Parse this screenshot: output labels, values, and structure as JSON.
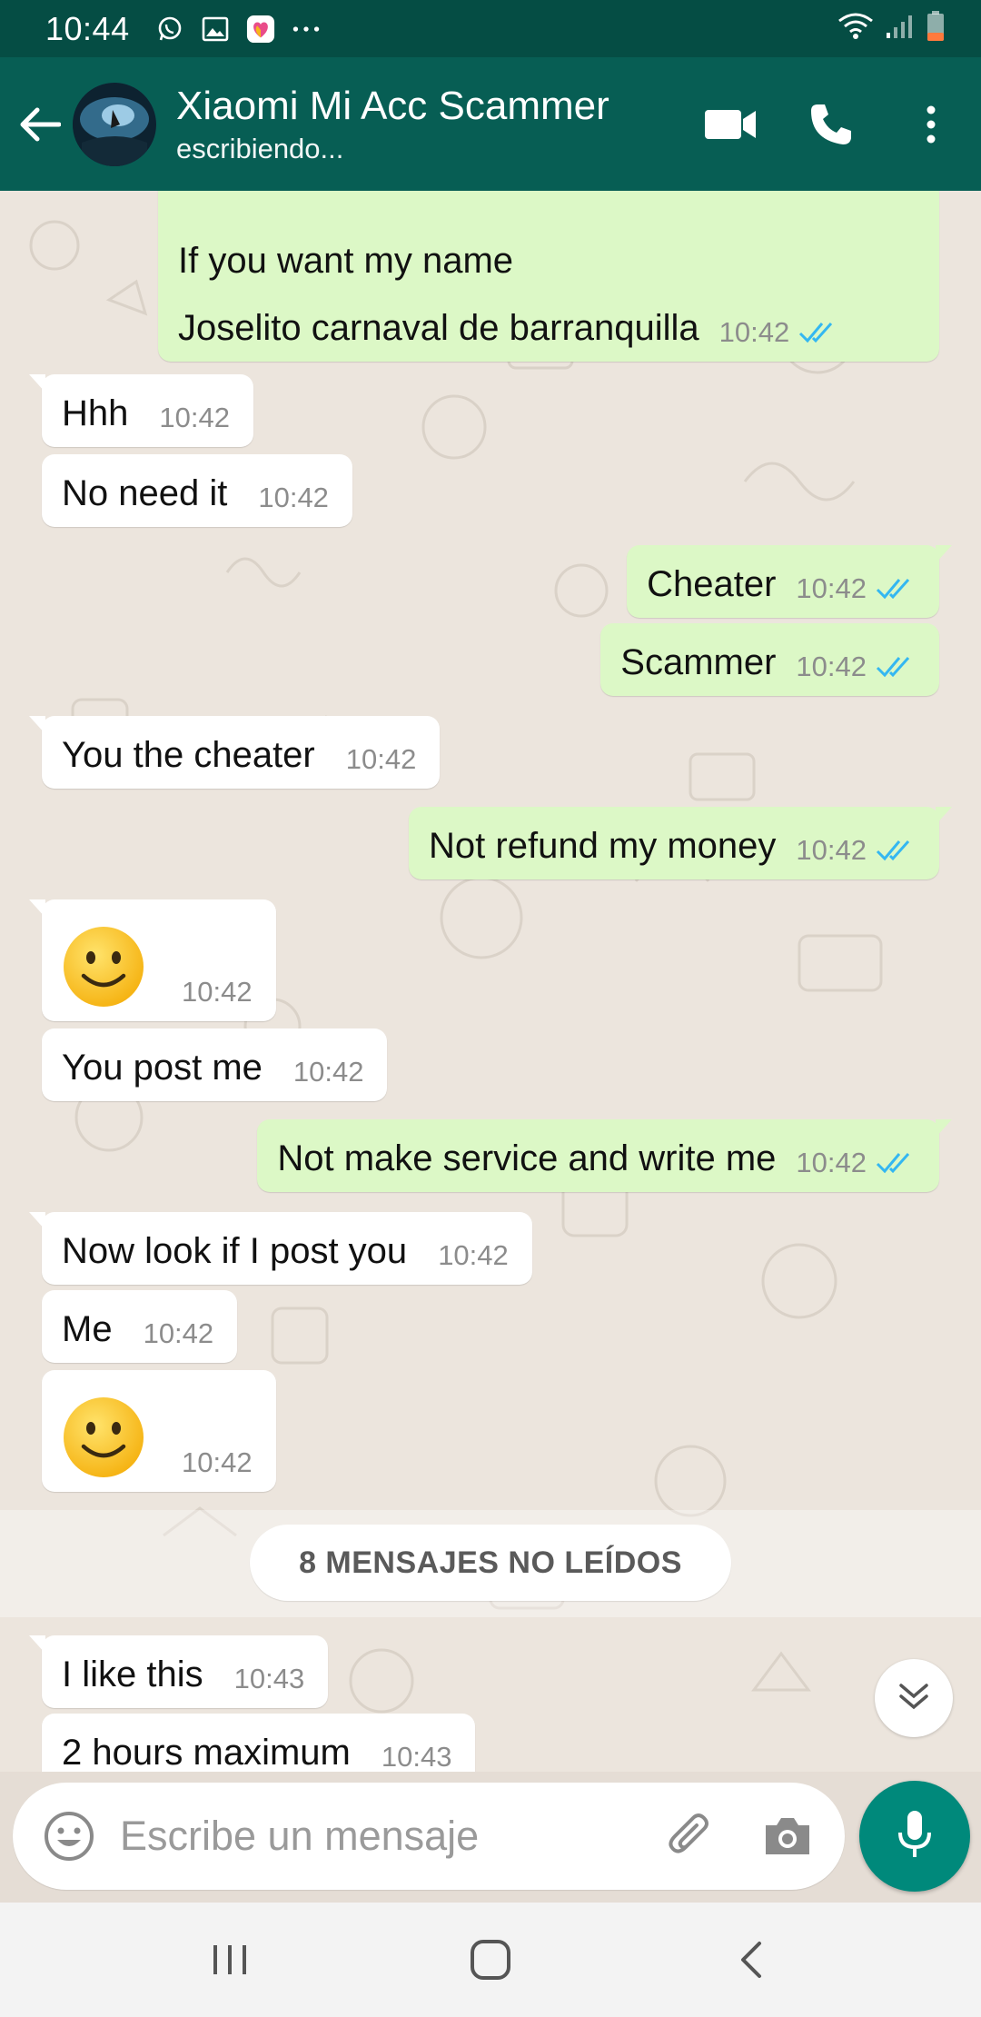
{
  "status_bar": {
    "time": "10:44",
    "icons": [
      "whatsapp-icon",
      "gallery-icon",
      "likee-icon",
      "more-dots-icon"
    ],
    "right_icons": [
      "wifi-icon",
      "signal-icon",
      "battery-icon"
    ]
  },
  "header": {
    "contact_name": "Xiaomi Mi Acc Scammer",
    "contact_status": "escribiendo...",
    "actions": [
      "video-call-icon",
      "voice-call-icon",
      "overflow-menu-icon"
    ]
  },
  "messages": [
    {
      "dir": "out",
      "text": "If you want my name",
      "time": "",
      "ticks": false
    },
    {
      "dir": "out",
      "text": "Joselito carnaval de barranquilla",
      "time": "10:42",
      "ticks": true
    },
    {
      "dir": "in",
      "text": "Hhh",
      "time": "10:42"
    },
    {
      "dir": "in",
      "text": "No need it",
      "time": "10:42"
    },
    {
      "dir": "out",
      "text": "Cheater",
      "time": "10:42",
      "ticks": true
    },
    {
      "dir": "out",
      "text": "Scammer",
      "time": "10:42",
      "ticks": true
    },
    {
      "dir": "in",
      "text": "You the cheater",
      "time": "10:42"
    },
    {
      "dir": "out",
      "text": "Not refund my money",
      "time": "10:42",
      "ticks": true
    },
    {
      "dir": "in",
      "emoji": "slightly-smiling-face",
      "time": "10:42"
    },
    {
      "dir": "in",
      "text": "You post me",
      "time": "10:42"
    },
    {
      "dir": "out",
      "text": "Not make service and write me",
      "time": "10:42",
      "ticks": true
    },
    {
      "dir": "in",
      "text": "Now look if I post you",
      "time": "10:42"
    },
    {
      "dir": "in",
      "text": "Me",
      "time": "10:42"
    },
    {
      "dir": "in",
      "emoji": "slightly-smiling-face",
      "time": "10:42"
    },
    {
      "dir": "in",
      "text": "I like this",
      "time": "10:43"
    },
    {
      "dir": "in",
      "text": "2 hours maximum",
      "time": "10:43"
    }
  ],
  "unread_divider": "8 MENSAJES NO LEÍDOS",
  "composer": {
    "placeholder": "Escribe un mensaje",
    "icons": [
      "emoji-icon",
      "attach-icon",
      "camera-icon",
      "mic-icon"
    ]
  },
  "nav_bar": [
    "recent-apps-icon",
    "home-icon",
    "back-icon"
  ],
  "colors": {
    "status_bar": "#054d44",
    "app_bar": "#075e54",
    "outgoing_bubble": "#dcf8c6",
    "incoming_bubble": "#ffffff",
    "read_ticks": "#34b7f1",
    "mic_button": "#00897b"
  }
}
